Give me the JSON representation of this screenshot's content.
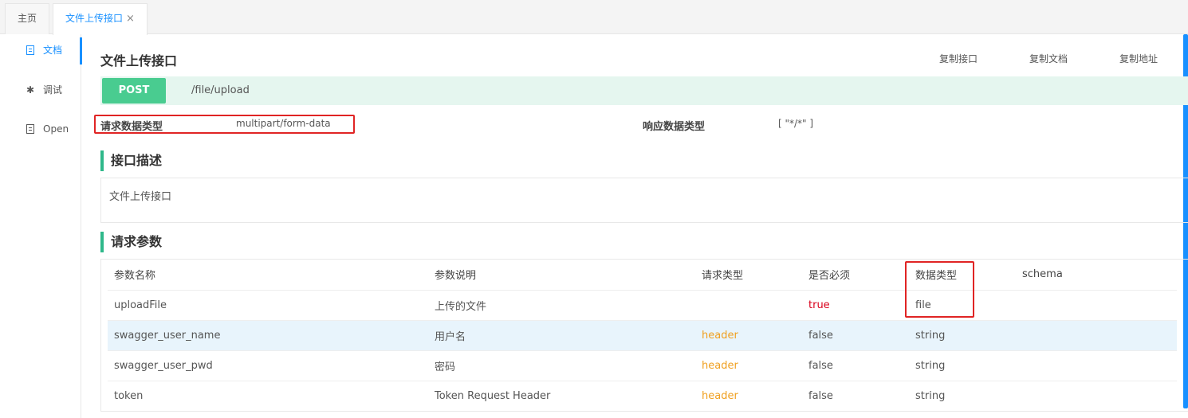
{
  "tabs": {
    "home_label": "主页",
    "active_label": "文件上传接口",
    "close_glyph": "×"
  },
  "sidenav": {
    "items": [
      {
        "label": "文档",
        "icon": "document-icon",
        "active": true
      },
      {
        "label": "调试",
        "icon": "bug-icon",
        "active": false
      },
      {
        "label": "Open",
        "icon": "file-icon",
        "active": false
      }
    ]
  },
  "api": {
    "title": "文件上传接口",
    "copy_api_label": "复制接口",
    "copy_doc_label": "复制文档",
    "copy_url_label": "复制地址",
    "method": "POST",
    "path": "/file/upload",
    "request_content_type_label": "请求数据类型",
    "request_content_type_value": "multipart/form-data",
    "response_content_type_label": "响应数据类型",
    "response_content_type_value": "[ \"*/*\" ]",
    "description_heading": "接口描述",
    "description_text": "文件上传接口",
    "params_heading": "请求参数"
  },
  "params_table": {
    "columns": [
      "参数名称",
      "参数说明",
      "请求类型",
      "是否必须",
      "数据类型",
      "schema"
    ],
    "rows": [
      {
        "name": "uploadFile",
        "desc": "上传的文件",
        "in": "",
        "required": "true",
        "type": "file",
        "schema": ""
      },
      {
        "name": "swagger_user_name",
        "desc": "用户名",
        "in": "header",
        "required": "false",
        "type": "string",
        "schema": ""
      },
      {
        "name": "swagger_user_pwd",
        "desc": "密码",
        "in": "header",
        "required": "false",
        "type": "string",
        "schema": ""
      },
      {
        "name": "token",
        "desc": "Token Request Header",
        "in": "header",
        "required": "false",
        "type": "string",
        "schema": ""
      }
    ]
  },
  "colors": {
    "accent": "#1890ff",
    "post_method": "#49cc90",
    "section_bar": "#2eb88a",
    "required_true": "#d9001b",
    "header_in": "#f0a020",
    "highlight_box": "#e02424"
  }
}
